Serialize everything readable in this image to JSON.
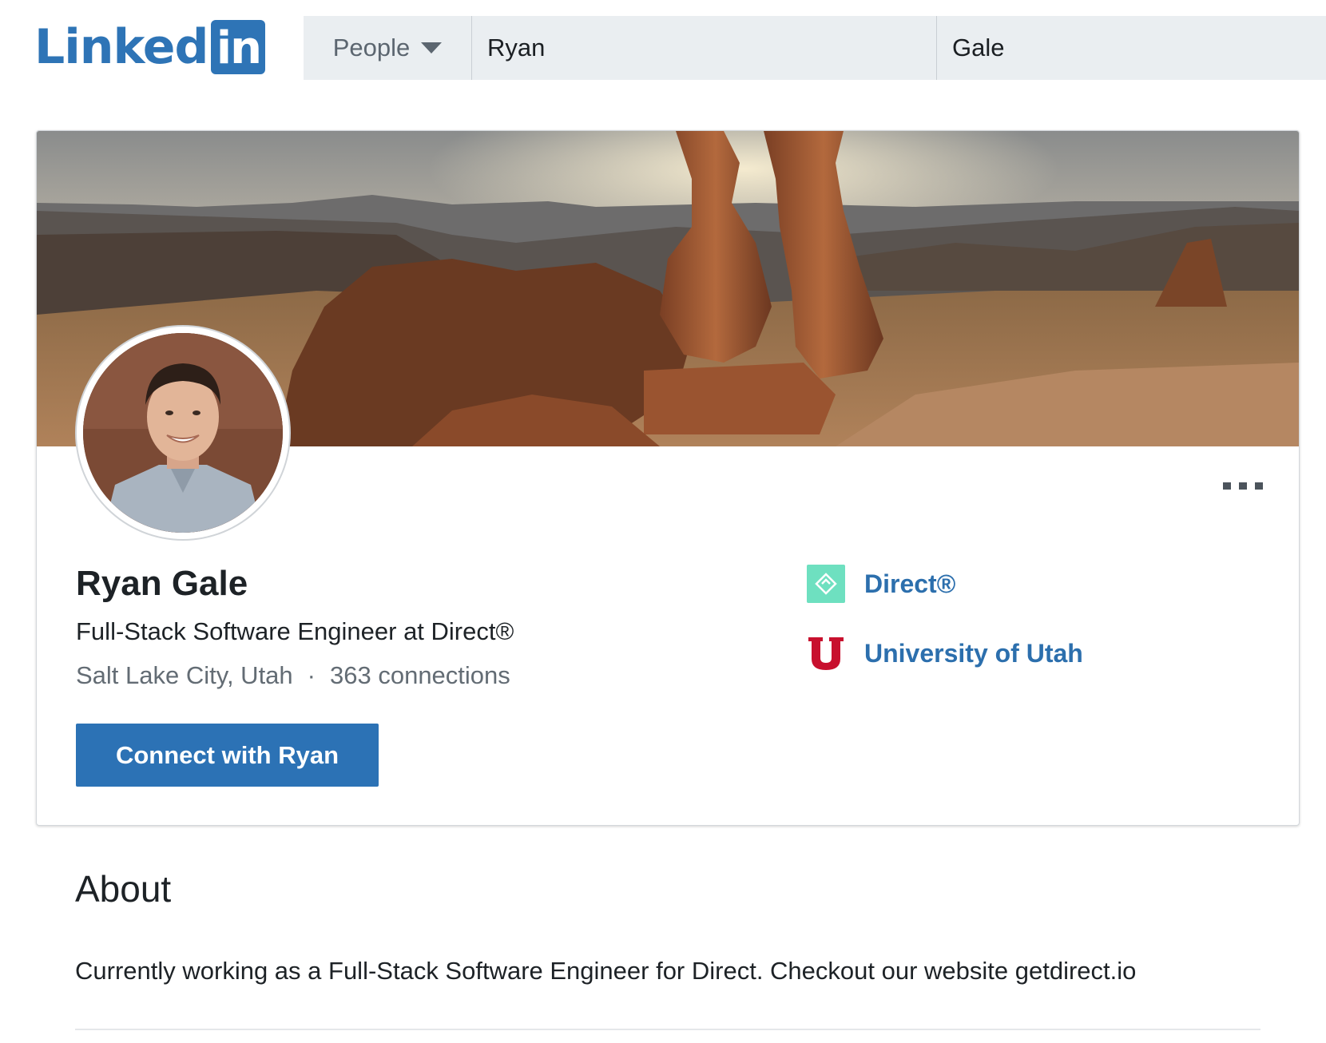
{
  "header": {
    "logo": "Linkedin",
    "search_type": "People",
    "first_name": "Ryan",
    "last_name": "Gale"
  },
  "profile": {
    "name": "Ryan Gale",
    "headline": "Full-Stack Software Engineer at Direct®",
    "location": "Salt Lake City, Utah",
    "separator": "·",
    "connections": "363 connections",
    "connect_label": "Connect with Ryan",
    "more_icon": "ellipsis-icon"
  },
  "orgs": [
    {
      "name": "Direct®",
      "icon": "direct-logo-icon",
      "color": "#6ee0c0"
    },
    {
      "name": "University of Utah",
      "icon": "university-utah-logo-icon",
      "color": "#c8102e"
    }
  ],
  "about": {
    "title": "About",
    "text": "Currently working as a Full-Stack Software Engineer for Direct. Checkout our website getdirect.io"
  },
  "colors": {
    "brand": "#2e74b6",
    "link": "#2c6fad",
    "search_bg": "#eaeef1"
  }
}
